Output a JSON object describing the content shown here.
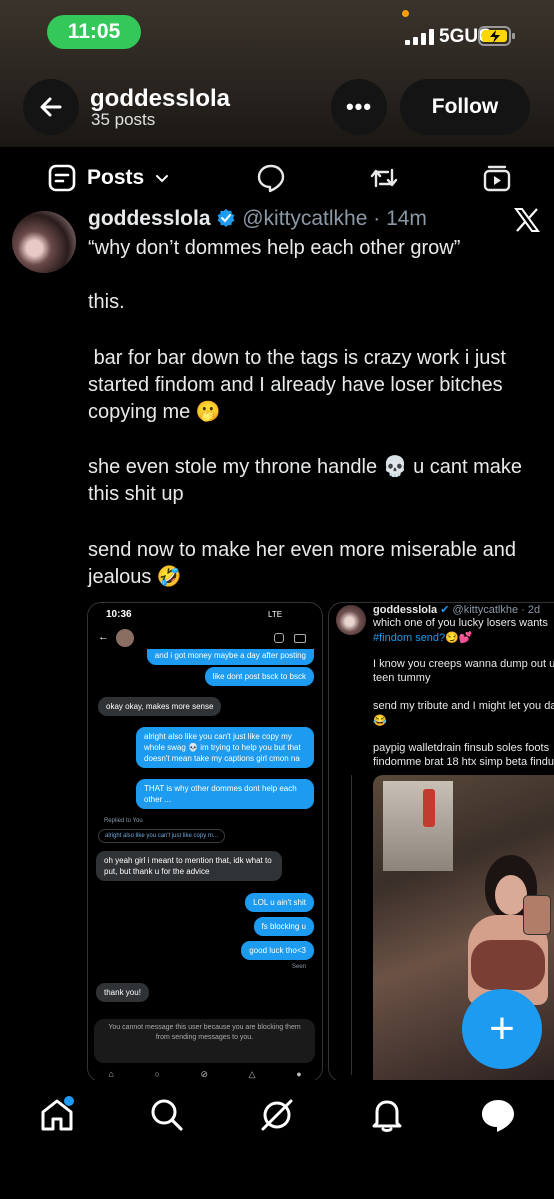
{
  "status_bar": {
    "time": "11:05",
    "network": "5GUC"
  },
  "header": {
    "name": "goddesslola",
    "posts": "35 posts",
    "follow_label": "Follow",
    "more_label": "•••"
  },
  "tabs": {
    "posts_label": "Posts"
  },
  "tweet": {
    "name": "goddesslola",
    "handle": "@kittycatlkhe · 14m",
    "quote": "“why don’t dommes help each other grow”",
    "p1": "this.",
    "p2": " bar for bar down to the tags is crazy work i just started findom and I already have loser bitches copying me 🫢",
    "p3": "she even stole my throne handle 💀 u cant make this shit up",
    "p4": "send now to make her even more miserable and jealous 🤣"
  },
  "embed_left": {
    "time": "10:36",
    "status": "LTE",
    "msg_top": "and i got money maybe a day after posting",
    "msg1": "like dont post bsck to bsck",
    "msg2": "okay okay, makes more sense",
    "msg3": "alright also like you can't just like copy my whole swag 💀 im trying to help you but that doesn't mean take my captions girl cmon na",
    "msg4": "THAT is why other dommes dont help each other ...",
    "replied": "Replied to You",
    "replied_quote": "alright also like you can't just like copy m...",
    "msg5": "oh yeah girl i meant to mention that, idk what to put, but thank u for the advice",
    "msg6": "LOL u ain't shit",
    "msg7": "fs blocking u",
    "msg8": "good luck tho<3",
    "seen": "Seen",
    "msg9": "thank you!",
    "blocked": "You cannot message this user because you are blocking them from sending messages to you."
  },
  "embed_right": {
    "name": "goddesslola",
    "handle": "@kittycatlkhe · 2d",
    "l1": "which one of you lucky losers wants",
    "l2": "#findom send?😏💕",
    "l3": "I know you creeps wanna dump out u",
    "l4": "teen tummy",
    "l5": "send my tribute and I might let you da",
    "l6": "😂",
    "l7": "paypig walletdrain finsub soles foots",
    "l8": "findomme brat 18 htx simp beta findu"
  },
  "fab_label": "+",
  "colors": {
    "accent": "#1d9bf0",
    "time_pill": "#34c759",
    "battery": "#ffd60a"
  }
}
